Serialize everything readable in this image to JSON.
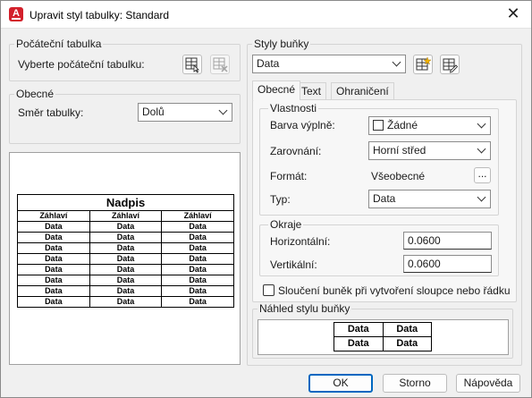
{
  "window": {
    "title": "Upravit styl tabulky: Standard"
  },
  "start_table": {
    "group_label": "Počáteční tabulka",
    "select_label": "Vyberte počáteční tabulku:"
  },
  "general": {
    "group_label": "Obecné",
    "direction_label": "Směr tabulky:",
    "direction_value": "Dolů"
  },
  "preview": {
    "title_row": "Nadpis",
    "header_cells": [
      "Záhlaví",
      "Záhlaví",
      "Záhlaví"
    ],
    "data_cell": "Data"
  },
  "cell_styles": {
    "group_label": "Styly buňky",
    "selected_style": "Data"
  },
  "tabs": [
    {
      "label": "Obecné",
      "active": true
    },
    {
      "label": "Text",
      "active": false
    },
    {
      "label": "Ohraničení",
      "active": false
    }
  ],
  "properties": {
    "group_label": "Vlastnosti",
    "fill_color_label": "Barva výplně:",
    "fill_color_value": "Žádné",
    "alignment_label": "Zarovnání:",
    "alignment_value": "Horní střed",
    "format_label": "Formát:",
    "format_value": "Všeobecné",
    "format_button": "...",
    "type_label": "Typ:",
    "type_value": "Data"
  },
  "margins": {
    "group_label": "Okraje",
    "horizontal_label": "Horizontální:",
    "horizontal_value": "0.0600",
    "vertical_label": "Vertikální:",
    "vertical_value": "0.0600"
  },
  "merge_checkbox": {
    "label": "Sloučení buněk při vytvoření sloupce nebo řádku",
    "checked": false
  },
  "cell_preview": {
    "group_label": "Náhled stylu buňky",
    "cells": [
      "Data",
      "Data",
      "Data",
      "Data"
    ]
  },
  "buttons": {
    "ok": "OK",
    "cancel": "Storno",
    "help": "Nápověda"
  }
}
